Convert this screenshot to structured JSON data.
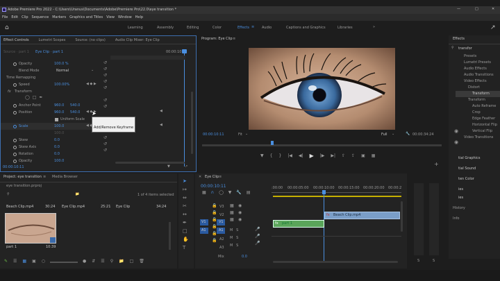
{
  "window": {
    "title": "Adobe Premiere Pro 2022 - C:\\Users\\Uranus\\Documents\\Adobe\\Premiere Pro\\22.0\\eye transition *"
  },
  "menu": [
    "File",
    "Edit",
    "Clip",
    "Sequence",
    "Markers",
    "Graphics and Titles",
    "View",
    "Window",
    "Help"
  ],
  "workspaces": [
    "Learning",
    "Assembly",
    "Editing",
    "Color",
    "Effects",
    "Audio",
    "Captions and Graphics",
    "Libraries"
  ],
  "effect_controls": {
    "tabs": [
      "Effect Controls",
      "Lumetri Scopes",
      "Source: (no clips)",
      "Audio Clip Mixer: Eye Clip"
    ],
    "source": "Source · part 1",
    "clip": "Eye Clip · part 1",
    "timecode_top": "00:00:10",
    "rows": [
      {
        "label": "Opacity",
        "value": "100.0 %"
      },
      {
        "label": "Blend Mode",
        "value": "Normal"
      },
      {
        "label": "Time Remapping",
        "value": ""
      },
      {
        "label": "Speed",
        "value": "100.00%"
      },
      {
        "label": "Transform",
        "value": ""
      },
      {
        "label": "Anchor Point",
        "value": "960.0",
        "value2": "540.0"
      },
      {
        "label": "Position",
        "value": "960.0",
        "value2": "540.0"
      },
      {
        "label": "Uniform Scale",
        "value": ""
      },
      {
        "label": "Scale",
        "value": "100.0"
      },
      {
        "label": "",
        "value": "100.0"
      },
      {
        "label": "Skew",
        "value": "0.0"
      },
      {
        "label": "Skew Axis",
        "value": "0.0"
      },
      {
        "label": "Rotation",
        "value": "0.0"
      },
      {
        "label": "Opacity",
        "value": "100.0"
      }
    ],
    "tooltip": "Add/Remove Keyframe",
    "timecode_bottom": "00:00:10:11"
  },
  "program": {
    "title": "Program: Eye Clip",
    "timecode": "00:00:10:11",
    "fit": "Fit",
    "quality": "Full",
    "duration": "00:00:34:24"
  },
  "effects_panel": {
    "title": "Effects",
    "search": "transfor",
    "tree": [
      "Presets",
      "Lumetri Presets",
      "Audio Effects",
      "Audio Transitions",
      "Video Effects",
      "Distort",
      "Transform",
      "Transform",
      "Auto Reframe",
      "Crop",
      "Edge Feather",
      "Horizontal Flip",
      "Vertical Flip",
      "Video Transitions"
    ],
    "side_items": [
      "tial Graphics",
      "tial Sound",
      "ten Color",
      "ies",
      "ies",
      "History",
      "Info"
    ]
  },
  "project": {
    "tabs": [
      "Project: eye transition",
      "Media Browser"
    ],
    "file": "eye transition.prproj",
    "items_selected": "1 of 4 items selected",
    "bins": [
      {
        "name": "Beach Clip.mp4",
        "duration": "30:24"
      },
      {
        "name": "Eye Clip.mp4",
        "duration": "25:21"
      },
      {
        "name": "Eye Clip",
        "duration": "34:24"
      }
    ],
    "thumb_name": "part 1",
    "thumb_duration": "10:39"
  },
  "timeline": {
    "title": "Eye Clip",
    "timecode": "00:00:10:11",
    "ruler": [
      ":00:00",
      "00:00:05:00",
      "00:00:10:00",
      "00:00:15:00",
      "00:00:20:00",
      "00:00:2"
    ],
    "tracks": [
      "V3",
      "V2",
      "V1",
      "A1",
      "A2",
      "A3"
    ],
    "src_v": "V1",
    "src_a": "A1",
    "mix": "Mix",
    "mix_value": "0.0",
    "clips": [
      {
        "name": "Beach Clip.mp4",
        "track": "V2"
      },
      {
        "name": "part 1",
        "track": "V1"
      }
    ]
  },
  "meter": {
    "left": "S",
    "right": "S"
  }
}
